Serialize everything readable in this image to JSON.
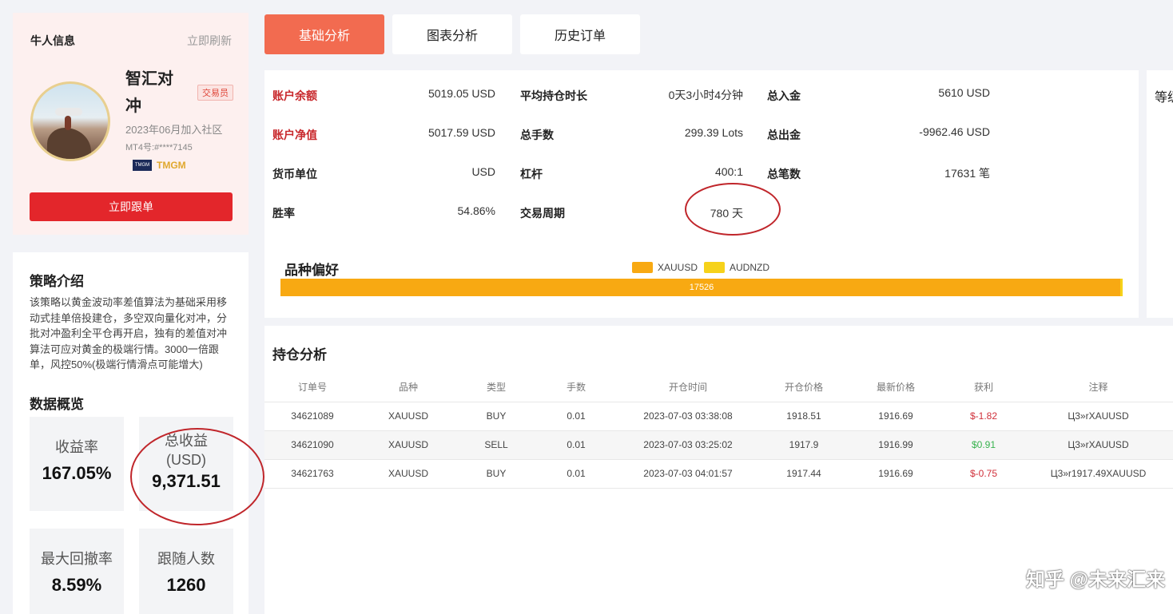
{
  "profile": {
    "section_title": "牛人信息",
    "refresh_label": "立即刷新",
    "name": "智汇对冲",
    "role": "交易员",
    "joined": "2023年06月加入社区",
    "mt4": "MT4号:#****7145",
    "broker": "TMGM",
    "broker_logo": "TMGM",
    "follow_label": "立即跟单"
  },
  "strategy": {
    "title": "策略介绍",
    "text": "该策略以黄金波动率差值算法为基础采用移动式挂单倍投建仓，多空双向量化对冲，分批对冲盈利全平仓再开启，独有的差值对冲算法可应对黄金的极端行情。3000一倍跟单，风控50%(极端行情滑点可能增大)"
  },
  "overview": {
    "title": "数据概览",
    "stats": [
      {
        "label": "收益率",
        "value": "167.05%"
      },
      {
        "label": "总收益\n(USD)",
        "value": "9,371.51"
      },
      {
        "label": "最大回撤率",
        "value": "8.59%"
      },
      {
        "label": "跟随人数",
        "value": "1260"
      }
    ]
  },
  "tabs": [
    "基础分析",
    "图表分析",
    "历史订单"
  ],
  "account": {
    "col1": [
      {
        "label": "账户余额",
        "value": "5019.05 USD"
      },
      {
        "label": "账户净值",
        "value": "5017.59 USD"
      },
      {
        "label": "货币单位",
        "value": "USD"
      },
      {
        "label": "胜率",
        "value": "54.86%"
      }
    ],
    "col2": [
      {
        "label": "平均持仓时长",
        "value": "0天3小时4分钟"
      },
      {
        "label": "总手数",
        "value": "299.39 Lots"
      },
      {
        "label": "杠杆",
        "value": "400:1"
      },
      {
        "label": "交易周期",
        "value": "780 天"
      }
    ],
    "col3": [
      {
        "label": "总入金",
        "value": "5610 USD"
      },
      {
        "label": "总出金",
        "value": "-9962.46 USD"
      },
      {
        "label": "总笔数",
        "value": "17631 笔"
      }
    ]
  },
  "side_panel_text": "等级",
  "preference": {
    "title": "品种偏好",
    "legend": [
      {
        "name": "XAUUSD",
        "color": "#f8a912"
      },
      {
        "name": "AUDNZD",
        "color": "#f6d21a"
      }
    ],
    "bar_value": "17526"
  },
  "positions": {
    "title": "持仓分析",
    "headers": [
      "订单号",
      "品种",
      "类型",
      "手数",
      "开仓时间",
      "开仓价格",
      "最新价格",
      "获利",
      "注释"
    ],
    "rows": [
      [
        "34621089",
        "XAUUSD",
        "BUY",
        "0.01",
        "2023-07-03 03:38:08",
        "1918.51",
        "1916.69",
        "$-1.82",
        "Ц3»rXAUUSD"
      ],
      [
        "34621090",
        "XAUUSD",
        "SELL",
        "0.01",
        "2023-07-03 03:25:02",
        "1917.9",
        "1916.99",
        "$0.91",
        "Ц3»rXAUUSD"
      ],
      [
        "34621763",
        "XAUUSD",
        "BUY",
        "0.01",
        "2023-07-03 04:01:57",
        "1917.44",
        "1916.69",
        "$-0.75",
        "Ц3»r1917.49XAUUSD"
      ]
    ]
  },
  "watermark": "知乎 @未来汇来"
}
